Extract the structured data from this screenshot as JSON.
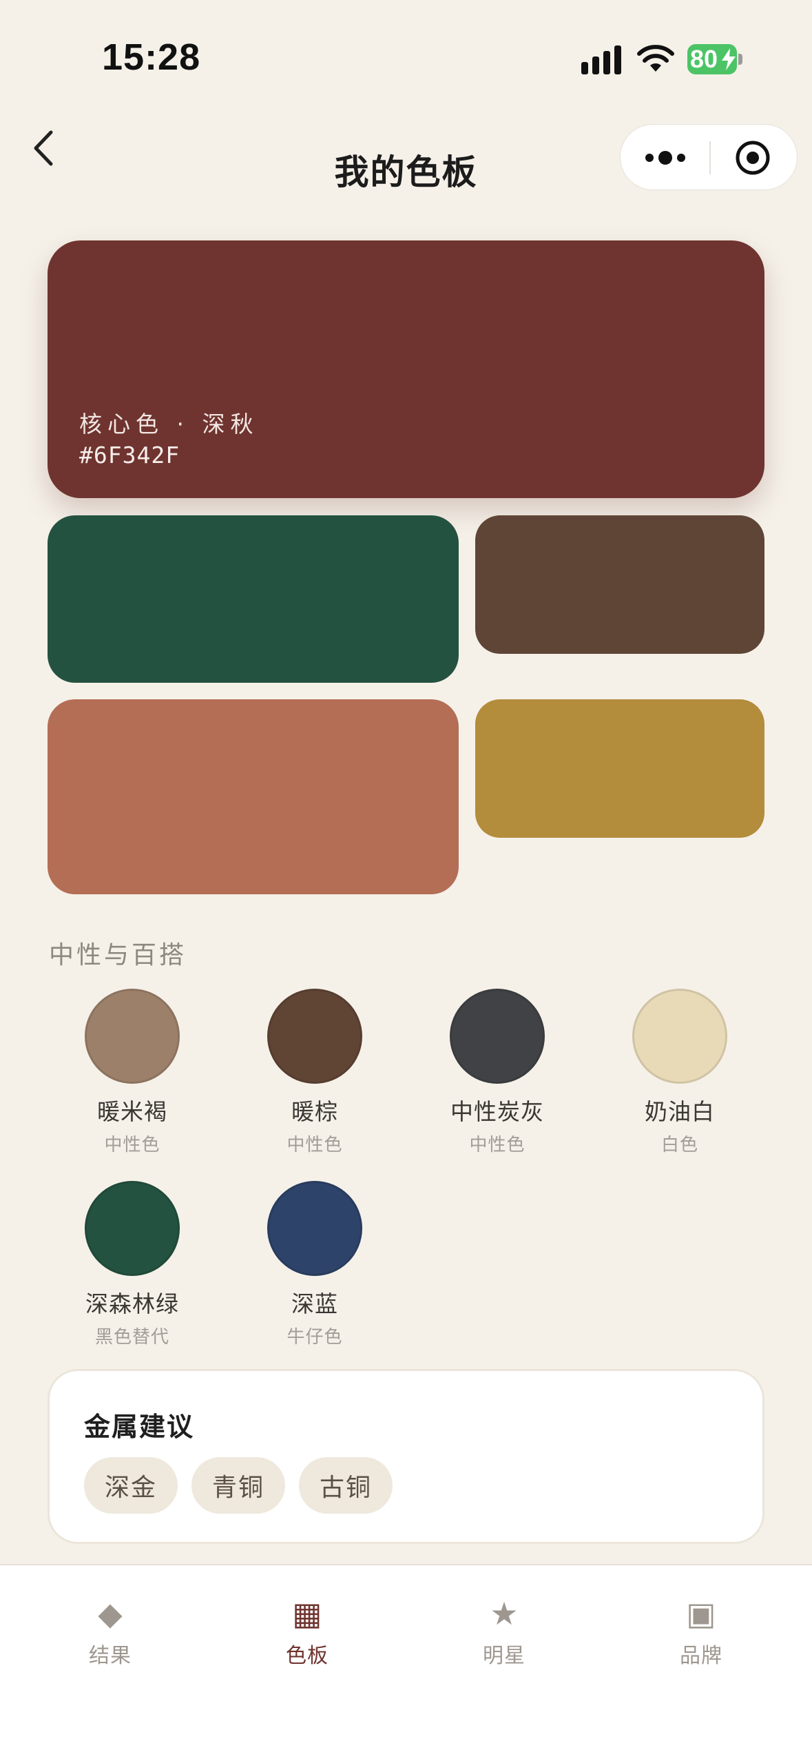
{
  "status_bar": {
    "time": "15:28",
    "battery": "80"
  },
  "nav": {
    "title": "我的色板"
  },
  "palette": {
    "core": {
      "label": "核心色 · 深秋",
      "hex": "#6F342F",
      "color": "#6F342F"
    },
    "swatches": [
      {
        "color": "#245240"
      },
      {
        "color": "#5F4535"
      },
      {
        "color": "#B46E55"
      },
      {
        "color": "#B38C3C"
      }
    ]
  },
  "neutrals": {
    "title": "中性与百搭",
    "items": [
      {
        "name": "暖米褐",
        "sub": "中性色",
        "color": "#9C806A"
      },
      {
        "name": "暖棕",
        "sub": "中性色",
        "color": "#604535"
      },
      {
        "name": "中性炭灰",
        "sub": "中性色",
        "color": "#414245"
      },
      {
        "name": "奶油白",
        "sub": "白色",
        "color": "#E8DAB7"
      },
      {
        "name": "深森林绿",
        "sub": "黑色替代",
        "color": "#245240"
      },
      {
        "name": "深蓝",
        "sub": "牛仔色",
        "color": "#2E4369"
      }
    ]
  },
  "metals": {
    "title": "金属建议",
    "tags": [
      "深金",
      "青铜",
      "古铜"
    ]
  },
  "tabs": [
    {
      "label": "结果",
      "icon": "◆",
      "icon_name": "diamond-icon",
      "active": false
    },
    {
      "label": "色板",
      "icon": "▦",
      "icon_name": "grid-icon",
      "active": true
    },
    {
      "label": "明星",
      "icon": "★",
      "icon_name": "star-icon",
      "active": false
    },
    {
      "label": "品牌",
      "icon": "▣",
      "icon_name": "square-icon",
      "active": false
    }
  ],
  "colors": {
    "background": "#F5F1E9",
    "accent": "#6F342F",
    "tab_inactive": "#9E978F"
  }
}
